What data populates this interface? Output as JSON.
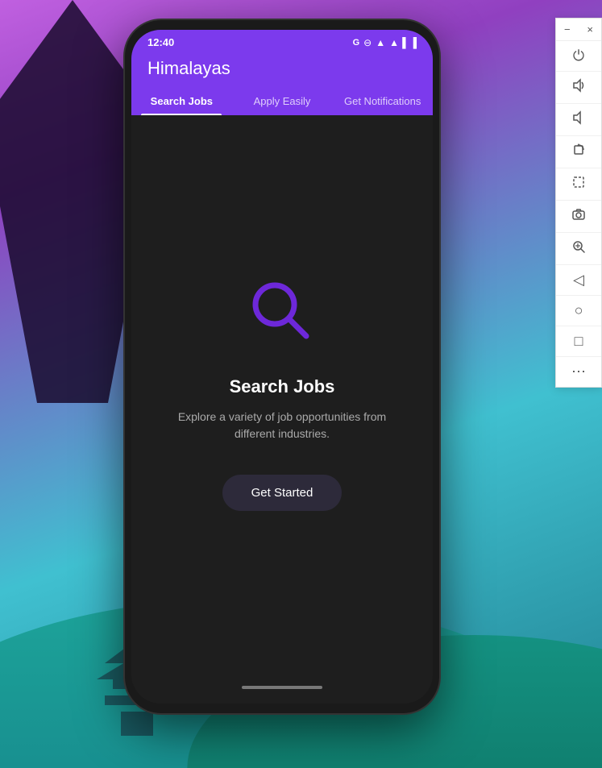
{
  "background": {
    "gradient_start": "#c060e0",
    "gradient_end": "#208090"
  },
  "phone": {
    "status_bar": {
      "time": "12:40",
      "google_indicator": "G",
      "battery_icon": "🔋",
      "signal_icons": "▲▲"
    },
    "app_bar": {
      "title": "Himalayas"
    },
    "tabs": [
      {
        "label": "Search Jobs",
        "active": true
      },
      {
        "label": "Apply Easily",
        "active": false
      },
      {
        "label": "Get Notifications",
        "active": false
      }
    ],
    "main_content": {
      "search_icon_label": "search-magnifier-icon",
      "title": "Search Jobs",
      "description": "Explore a variety of job opportunities from different industries.",
      "button_label": "Get Started"
    },
    "bottom_indicator": "home-indicator"
  },
  "side_panel": {
    "min_button": "−",
    "close_button": "×",
    "items": [
      {
        "icon": "⏻",
        "name": "power-icon"
      },
      {
        "icon": "🔊",
        "name": "volume-up-icon"
      },
      {
        "icon": "🔉",
        "name": "volume-down-icon"
      },
      {
        "icon": "◈",
        "name": "rotate-icon"
      },
      {
        "icon": "◇",
        "name": "edit-icon"
      },
      {
        "icon": "📷",
        "name": "screenshot-icon"
      },
      {
        "icon": "🔍",
        "name": "zoom-icon"
      },
      {
        "icon": "◁",
        "name": "back-icon"
      },
      {
        "icon": "○",
        "name": "home-icon"
      },
      {
        "icon": "□",
        "name": "recents-icon"
      },
      {
        "icon": "⋯",
        "name": "more-icon"
      }
    ]
  }
}
